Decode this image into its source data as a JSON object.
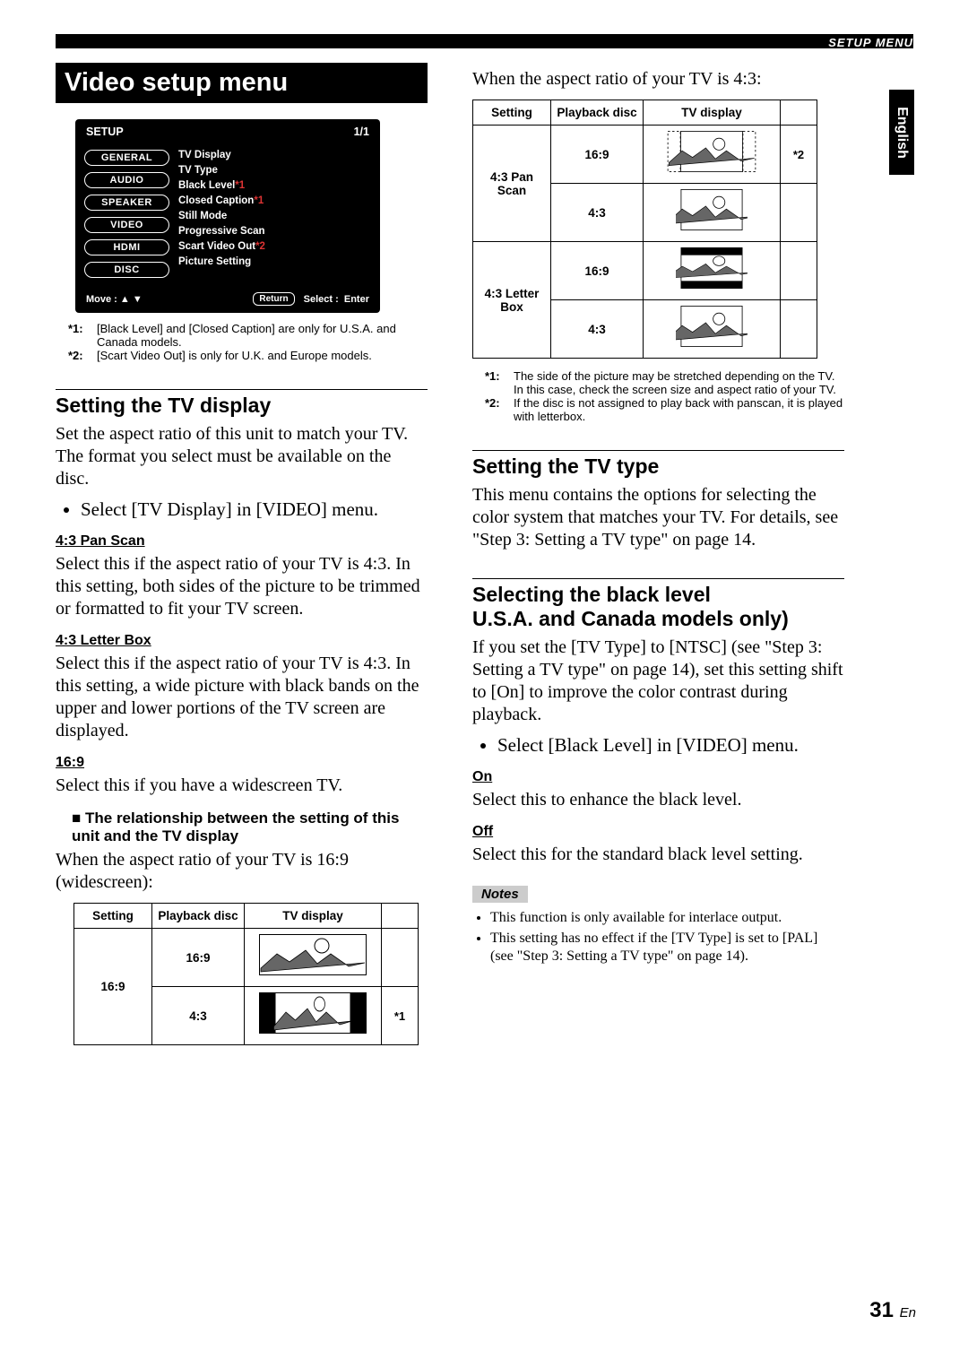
{
  "header": {
    "setup_menu_label": "SETUP MENU",
    "side_tab": "English"
  },
  "title": "Video setup menu",
  "osd": {
    "setup_label": "SETUP",
    "page_indicator": "1/1",
    "tabs": [
      "GENERAL",
      "AUDIO",
      "SPEAKER",
      "VIDEO",
      "HDMI",
      "DISC"
    ],
    "items": [
      {
        "label": "TV Display",
        "note": ""
      },
      {
        "label": "TV Type",
        "note": ""
      },
      {
        "label": "Black Level",
        "note": "*1"
      },
      {
        "label": "Closed Caption",
        "note": "*1"
      },
      {
        "label": "Still Mode",
        "note": ""
      },
      {
        "label": "Progressive Scan",
        "note": ""
      },
      {
        "label": "Scart Video Out",
        "note": "*2"
      },
      {
        "label": "Picture Setting",
        "note": ""
      }
    ],
    "footer": {
      "move_label": "Move :",
      "return_label": "Return",
      "select_label": "Select :",
      "enter_label": "Enter"
    }
  },
  "osd_footnotes": {
    "n1": {
      "label": "*1:",
      "text": "[Black Level] and [Closed Caption] are only for U.S.A. and Canada models."
    },
    "n2": {
      "label": "*2:",
      "text": "[Scart Video Out] is only for U.K. and Europe models."
    }
  },
  "section_tv_display": {
    "heading": "Setting the TV display",
    "intro": "Set the aspect ratio of this unit to match your TV. The format you select must be available on the disc.",
    "bullet1": "Select [TV Display] in [VIDEO] menu.",
    "sub_panscan": {
      "heading": "4:3 Pan Scan",
      "text": "Select this if the aspect ratio of your TV is 4:3. In this setting, both sides of the picture to be trimmed or formatted to fit your TV screen."
    },
    "sub_letterbox": {
      "heading": "4:3 Letter Box",
      "text": "Select this if the aspect ratio of your TV is 4:3. In this setting, a wide picture with black bands on the upper and lower portions of the TV screen are displayed."
    },
    "sub_169": {
      "heading": "16:9",
      "text": "Select this if you have a widescreen TV."
    },
    "relation_heading": "The relationship between the setting of this unit and the TV display",
    "relation_caption": "When the aspect ratio of your TV is 16:9 (widescreen):"
  },
  "table_headers": {
    "setting": "Setting",
    "disc": "Playback disc",
    "display": "TV display"
  },
  "table_169": {
    "setting": "16:9",
    "rows": [
      {
        "disc": "16:9",
        "note": ""
      },
      {
        "disc": "4:3",
        "note": "*1"
      }
    ]
  },
  "right_intro": "When the aspect ratio of your TV is 4:3:",
  "table_43": {
    "rows": [
      {
        "setting": "4:3 Pan Scan",
        "disc": "16:9",
        "note": "*2"
      },
      {
        "setting": "",
        "disc": "4:3",
        "note": ""
      },
      {
        "setting": "4:3 Letter Box",
        "disc": "16:9",
        "note": ""
      },
      {
        "setting": "",
        "disc": "4:3",
        "note": ""
      }
    ]
  },
  "right_footnotes": {
    "n1": {
      "label": "*1:",
      "text": "The side of the picture may be stretched depending on the TV. In this case, check the screen size and aspect ratio of your TV."
    },
    "n2": {
      "label": "*2:",
      "text": "If the disc is not assigned to play back with panscan, it is played with letterbox."
    }
  },
  "section_tv_type": {
    "heading": "Setting the TV type",
    "text": "This menu contains the options for selecting the color system that matches your TV. For details, see \"Step 3: Setting a TV type\" on page 14."
  },
  "section_blacklevel": {
    "heading_l1": "Selecting the black level",
    "heading_l2": "U.S.A. and Canada models only)",
    "intro": "If you set the [TV Type] to [NTSC] (see \"Step 3: Setting a TV type\" on page 14), set this setting shift to [On] to improve the color contrast during playback.",
    "bullet1": "Select [Black Level] in [VIDEO] menu.",
    "on_h": "On",
    "on_t": "Select this to enhance the black level.",
    "off_h": "Off",
    "off_t": "Select this for the standard black level setting.",
    "notes_label": "Notes",
    "notes": [
      "This function is only available for interlace output.",
      "This setting has no effect if the [TV Type] is set to [PAL] (see \"Step 3: Setting a TV type\" on page 14)."
    ]
  },
  "page_number": {
    "num": "31",
    "suffix": "En"
  }
}
